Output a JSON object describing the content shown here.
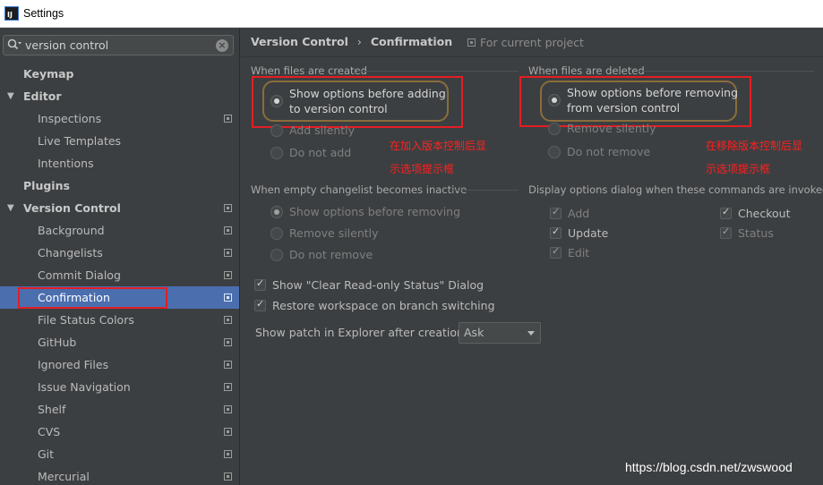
{
  "window": {
    "title": "Settings",
    "app_icon_text": "IJ"
  },
  "search": {
    "value": "version control"
  },
  "tree": {
    "items": [
      {
        "label": "Keymap"
      },
      {
        "label": "Editor"
      },
      {
        "label": "Inspections"
      },
      {
        "label": "Live Templates"
      },
      {
        "label": "Intentions"
      },
      {
        "label": "Plugins"
      },
      {
        "label": "Version Control"
      },
      {
        "label": "Background"
      },
      {
        "label": "Changelists"
      },
      {
        "label": "Commit Dialog"
      },
      {
        "label": "Confirmation"
      },
      {
        "label": "File Status Colors"
      },
      {
        "label": "GitHub"
      },
      {
        "label": "Ignored Files"
      },
      {
        "label": "Issue Navigation"
      },
      {
        "label": "Shelf"
      },
      {
        "label": "CVS"
      },
      {
        "label": "Git"
      },
      {
        "label": "Mercurial"
      }
    ]
  },
  "header": {
    "crumb1": "Version Control",
    "separator": "›",
    "crumb2": "Confirmation",
    "scope": "For current project"
  },
  "created": {
    "title": "When files are created",
    "options": [
      "Show options before adding to version control",
      "Add silently",
      "Do not add"
    ],
    "option0_line1": "Show options before adding",
    "option0_line2": "to version control"
  },
  "deleted": {
    "title": "When files are deleted",
    "option0_line1": "Show options before removing",
    "option0_line2": "from version control",
    "options": [
      "Show options before removing from version control",
      "Remove silently",
      "Do not remove"
    ]
  },
  "changelist": {
    "title": "When empty changelist becomes inactive",
    "options": [
      "Show options before removing",
      "Remove silently",
      "Do not remove"
    ]
  },
  "display": {
    "title": "Display options dialog when these commands are invoked",
    "left": [
      "Add",
      "Update",
      "Edit"
    ],
    "right": [
      "Checkout",
      "Status"
    ]
  },
  "checks": {
    "clear_readonly": "Show \"Clear Read-only Status\" Dialog",
    "restore_workspace": "Restore workspace on branch switching"
  },
  "patch": {
    "label": "Show patch in Explorer after creation:",
    "value": "Ask"
  },
  "annotations": {
    "left_line1": "在加入版本控制后显",
    "left_line2": "示选项提示框",
    "right_line1": "在移除版本控制后显",
    "right_line2": "示选项提示框"
  },
  "watermark": "https://blog.csdn.net/zwswood",
  "colors": {
    "selection": "#4b6eaf",
    "background": "#3c3f41",
    "annotation_red": "#e31e24"
  }
}
